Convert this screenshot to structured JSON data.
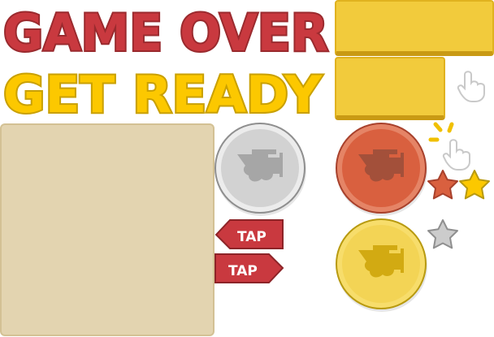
{
  "titles": {
    "game_over": "GAME OVER",
    "get_ready": "GET READY"
  },
  "buttons": {
    "tap_left": "TAP",
    "tap_right": "TAP"
  },
  "medals": [
    {
      "name": "silver",
      "color": "#d2d2d2"
    },
    {
      "name": "bronze",
      "color": "#d9603f"
    },
    {
      "name": "gold",
      "color": "#f3d455"
    }
  ],
  "stars": [
    {
      "name": "bronze",
      "color": "#d9603f"
    },
    {
      "name": "gold",
      "color": "#fcc800"
    },
    {
      "name": "silver",
      "color": "#cccccc"
    }
  ],
  "colors": {
    "red": "#c9393f",
    "yellow": "#fcc800",
    "panel_yellow": "#f2cb3c",
    "panel_beige": "#e3d4b0"
  },
  "icons": [
    "pointer-hand-icon",
    "tap-hand-icon",
    "airplane-silhouette-icon",
    "star-icon"
  ]
}
